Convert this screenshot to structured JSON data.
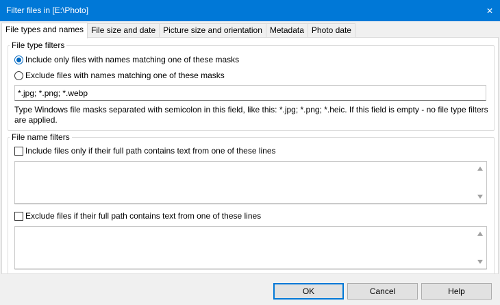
{
  "window": {
    "title": "Filter files in [E:\\Photo]",
    "close_glyph": "✕"
  },
  "tabs": [
    {
      "label": "File types and names",
      "active": true
    },
    {
      "label": "File size and date",
      "active": false
    },
    {
      "label": "Picture size and orientation",
      "active": false
    },
    {
      "label": "Metadata",
      "active": false
    },
    {
      "label": "Photo date",
      "active": false
    }
  ],
  "file_type_filters": {
    "legend": "File type filters",
    "include_option": {
      "label": "Include only files with names matching one of these masks",
      "selected": true
    },
    "exclude_option": {
      "label": "Exclude files with names matching one of these masks",
      "selected": false
    },
    "masks_value": "*.jpg; *.png; *.webp",
    "hint": "Type Windows file masks separated with semicolon in this field, like this: *.jpg; *.png; *.heic. If this field is empty - no file type filters are applied."
  },
  "file_name_filters": {
    "legend": "File name filters",
    "include_lines": {
      "label": "Include files only if their full path contains text from one of these lines",
      "checked": false,
      "value": ""
    },
    "exclude_lines": {
      "label": "Exclude files if their full path contains text from one of these lines",
      "checked": false,
      "value": ""
    }
  },
  "buttons": {
    "ok": "OK",
    "cancel": "Cancel",
    "help": "Help"
  },
  "colors": {
    "titlebar": "#0078d7",
    "accent": "#0067c0"
  },
  "icons": {
    "close": "close-icon",
    "scroll_up": "scroll-up-arrow-icon",
    "scroll_down": "scroll-down-arrow-icon"
  }
}
